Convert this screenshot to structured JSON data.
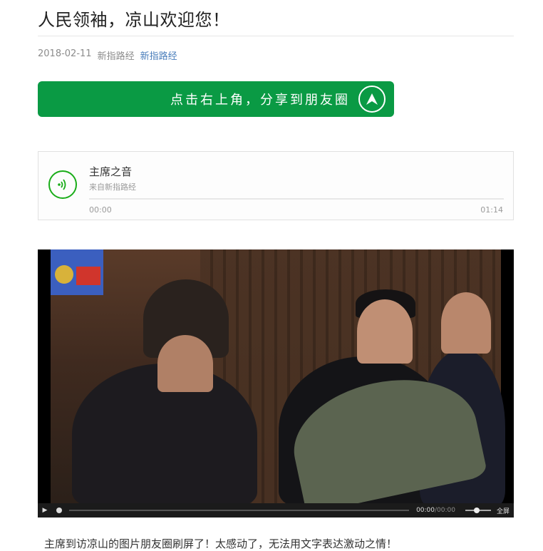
{
  "article": {
    "title": "人民领袖，凉山欢迎您！",
    "date": "2018-02-11",
    "author": "新指路经",
    "account_link": "新指路经"
  },
  "share_banner": {
    "label": "点击右上角，分享到朋友圈",
    "icon": "arrow-up-circle-icon",
    "color": "#0a9a44"
  },
  "audio": {
    "name": "主席之音",
    "source": "来自新指路经",
    "current_time": "00:00",
    "duration": "01:14",
    "progress": 0,
    "accent": "#1aad19"
  },
  "video": {
    "current_time": "00:00",
    "total_time": "00:00",
    "fullscreen_label": "全屏"
  },
  "caption": "主席到访凉山的图片朋友圈刷屏了！太感动了，无法用文字表达激动之情！"
}
